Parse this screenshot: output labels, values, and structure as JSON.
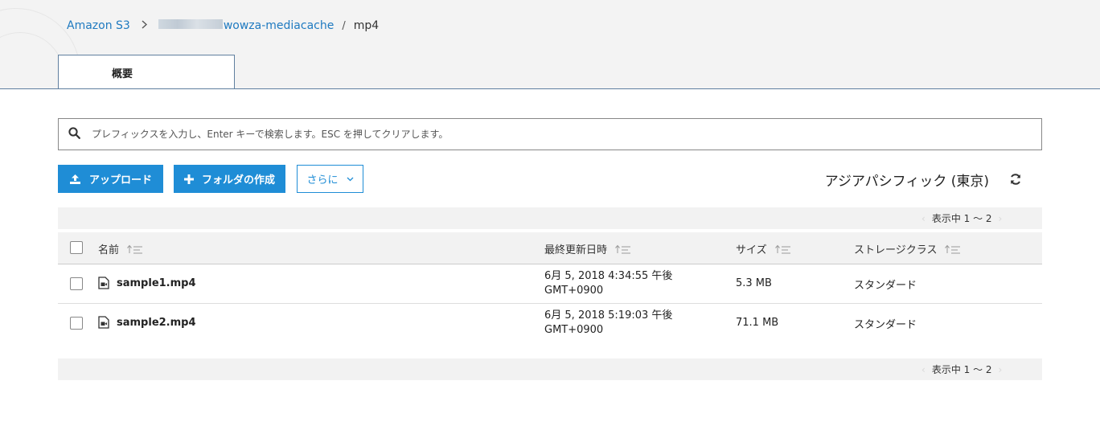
{
  "breadcrumb": {
    "root": "Amazon S3",
    "bucket_suffix": "wowza-mediacache",
    "separator_slash": "/",
    "current": "mp4"
  },
  "tabs": [
    {
      "label": "概要",
      "active": true
    }
  ],
  "search": {
    "placeholder": "プレフィックスを入力し、Enter キーで検索します。ESC を押してクリアします。",
    "value": ""
  },
  "toolbar": {
    "upload_label": "アップロード",
    "create_folder_label": "フォルダの作成",
    "more_label": "さらに",
    "region_label": "アジアパシフィック (東京)"
  },
  "pagination": {
    "label": "表示中 1 〜 2"
  },
  "table": {
    "columns": [
      "名前",
      "最終更新日時",
      "サイズ",
      "ストレージクラス"
    ],
    "rows": [
      {
        "name": "sample1.mp4",
        "modified_line1": "6月 5, 2018 4:34:55 午後",
        "modified_line2": "GMT+0900",
        "size": "5.3 MB",
        "storage_class": "スタンダード"
      },
      {
        "name": "sample2.mp4",
        "modified_line1": "6月 5, 2018 5:19:03 午後",
        "modified_line2": "GMT+0900",
        "size": "71.1 MB",
        "storage_class": "スタンダード"
      }
    ]
  },
  "colors": {
    "primary": "#1f8dd6",
    "link": "#1f7ac0",
    "tab_border": "#5f7f9f"
  },
  "icons": {
    "search": "search-icon",
    "upload": "upload-icon",
    "plus": "plus-icon",
    "chevron": "chevron-down-icon",
    "refresh": "refresh-icon",
    "sort": "sort-icon",
    "file": "video-file-icon"
  }
}
